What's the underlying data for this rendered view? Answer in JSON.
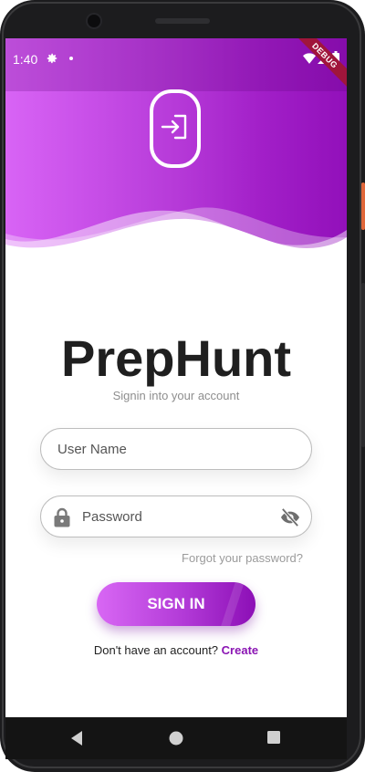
{
  "status_bar": {
    "time": "1:40",
    "icons": [
      "settings-icon",
      "notification-dot-icon",
      "wifi-icon",
      "signal-icon",
      "battery-icon"
    ],
    "debug_banner": "DEBUG"
  },
  "header": {
    "gradient_colors": [
      "#d864f5",
      "#9210ba"
    ],
    "badge_icon": "login-icon"
  },
  "app": {
    "title": "PrepHunt",
    "subtitle": "Signin into your account"
  },
  "form": {
    "username_placeholder": "User Name",
    "password_placeholder": "Password",
    "password_icon": "lock-icon",
    "visibility_icon": "visibility-off-icon",
    "forgot_label": "Forgot your password?",
    "signin_label": "SIGN IN"
  },
  "signup": {
    "prompt": "Don't have an account?",
    "link": "Create"
  },
  "colors": {
    "accent": "#8a14b3",
    "title_text": "#1f1f1f"
  },
  "navigation": {
    "buttons": [
      "back-icon",
      "home-icon",
      "recents-icon"
    ]
  }
}
